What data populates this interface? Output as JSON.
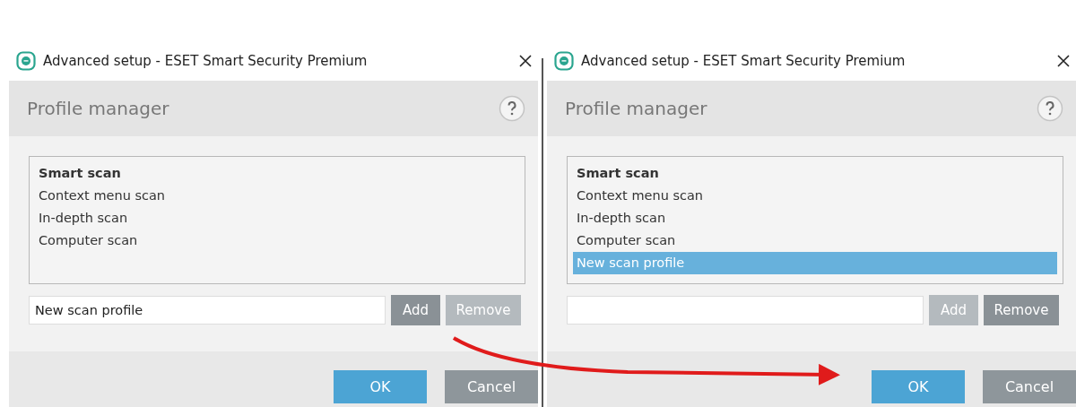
{
  "dialogs": [
    {
      "window": {
        "title": "Advanced setup - ESET Smart Security Premium"
      },
      "header": "Profile manager",
      "profiles": [
        {
          "label": "Smart scan",
          "default": true,
          "selected": false
        },
        {
          "label": "Context menu scan",
          "default": false,
          "selected": false
        },
        {
          "label": "In-depth scan",
          "default": false,
          "selected": false
        },
        {
          "label": "Computer scan",
          "default": false,
          "selected": false
        }
      ],
      "name_field": {
        "value": "New scan profile"
      },
      "add_button": {
        "label": "Add",
        "disabled": false
      },
      "remove_button": {
        "label": "Remove",
        "disabled": true
      },
      "buttons": [
        {
          "label": "OK",
          "kind": "primary"
        },
        {
          "label": "Cancel",
          "kind": "secondary"
        }
      ]
    },
    {
      "window": {
        "title": "Advanced setup - ESET Smart Security Premium"
      },
      "header": "Profile manager",
      "profiles": [
        {
          "label": "Smart scan",
          "default": true,
          "selected": false
        },
        {
          "label": "Context menu scan",
          "default": false,
          "selected": false
        },
        {
          "label": "In-depth scan",
          "default": false,
          "selected": false
        },
        {
          "label": "Computer scan",
          "default": false,
          "selected": false
        },
        {
          "label": "New scan profile",
          "default": false,
          "selected": true
        }
      ],
      "add_button": {
        "label": "Add",
        "disabled": true
      },
      "remove_button": {
        "label": "Remove",
        "disabled": false
      },
      "buttons": [
        {
          "label": "OK",
          "kind": "primary"
        },
        {
          "label": "Cancel",
          "kind": "secondary"
        }
      ]
    }
  ]
}
